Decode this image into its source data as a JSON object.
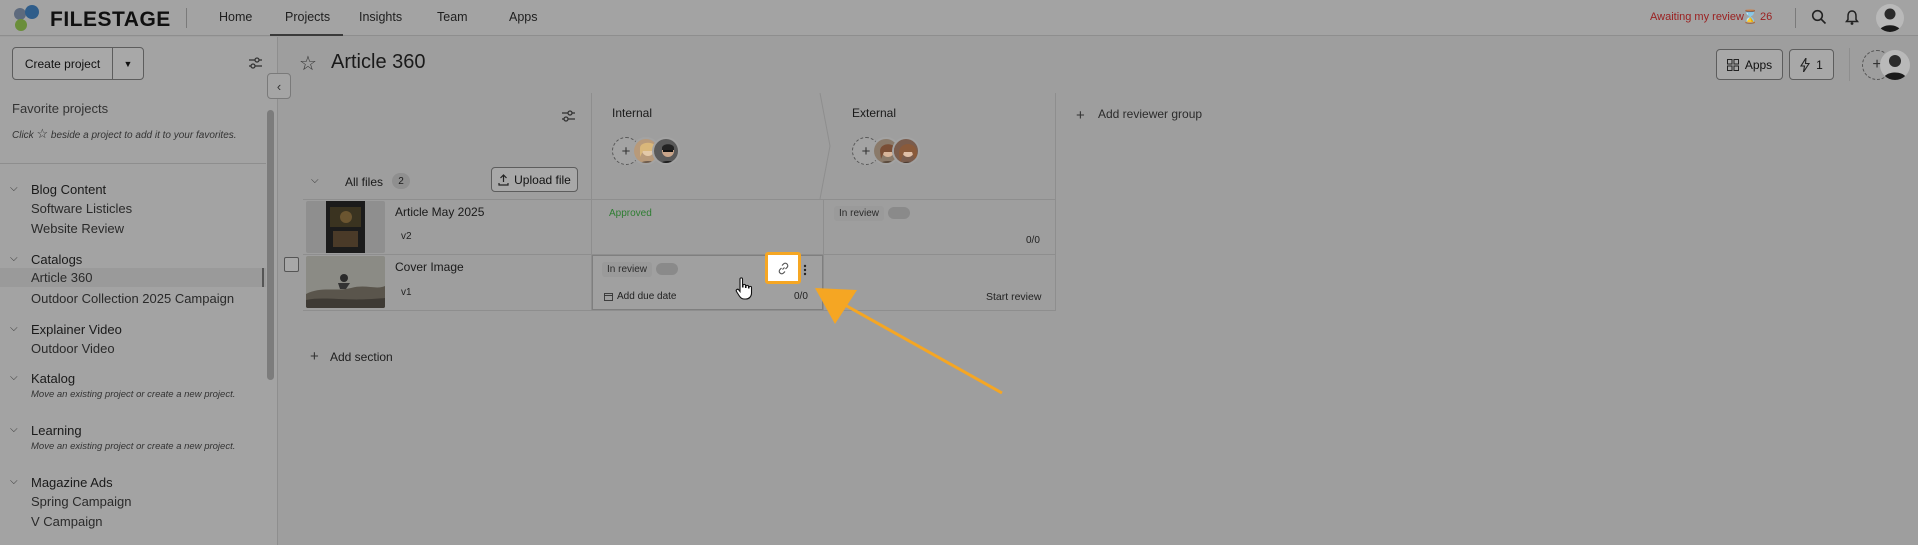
{
  "brand": {
    "logo_text": "FILESTAGE"
  },
  "nav": {
    "items": [
      {
        "label": "Home"
      },
      {
        "label": "Projects",
        "active": true
      },
      {
        "label": "Insights"
      },
      {
        "label": "Team"
      },
      {
        "label": "Apps"
      }
    ],
    "awaiting_label": "Awaiting my review",
    "awaiting_count": "26"
  },
  "sidebar": {
    "create_label": "Create project",
    "favorites_title": "Favorite projects",
    "favorites_hint_before": "Click",
    "favorites_hint_after": "beside a project to add it to your favorites.",
    "groups": [
      {
        "name": "Blog Content",
        "items": [
          "Software Listicles",
          "Website Review"
        ]
      },
      {
        "name": "Catalogs",
        "items": [
          "Article 360",
          "Outdoor Collection 2025 Campaign"
        ],
        "selected": "Article 360"
      },
      {
        "name": "Explainer Video",
        "items": [
          "Outdoor Video"
        ]
      },
      {
        "name": "Katalog",
        "hint": "Move an existing project or create a new project."
      },
      {
        "name": "Learning",
        "hint": "Move an existing project or create a new project."
      },
      {
        "name": "Magazine Ads",
        "items": [
          "Spring Campaign",
          "V Campaign"
        ]
      }
    ]
  },
  "project": {
    "title": "Article 360",
    "apps_label": "Apps",
    "automations_count": "1",
    "columns": {
      "internal": "Internal",
      "external": "External",
      "add_group": "Add reviewer group"
    },
    "files_section": {
      "label": "All files",
      "count": "2",
      "upload_label": "Upload file"
    },
    "files": [
      {
        "name": "Article May 2025",
        "version": "v2",
        "internal_status": "Approved",
        "external_status": "In review",
        "external_progress": "0/0"
      },
      {
        "name": "Cover Image",
        "version": "v1",
        "internal_status": "In review",
        "internal_due": "Add due date",
        "internal_progress": "0/0",
        "external_action": "Start review"
      }
    ],
    "add_section": "Add section"
  },
  "colors": {
    "approved": "#2e7d32",
    "awaiting": "#9a1f1f",
    "highlight": "#f5a623"
  }
}
